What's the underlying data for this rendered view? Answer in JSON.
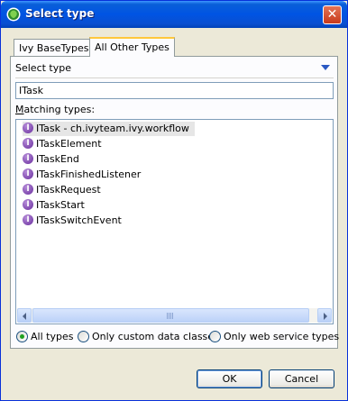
{
  "window": {
    "title": "Select type"
  },
  "tabs": [
    {
      "label": "Ivy BaseTypes"
    },
    {
      "label": "All Other Types"
    }
  ],
  "section": {
    "label": "Select type"
  },
  "search": {
    "value": "ITask"
  },
  "matching": {
    "label_prefix": "",
    "label_mnemonic": "M",
    "label_rest": "atching types:"
  },
  "list": {
    "items": [
      {
        "label": "ITask - ch.ivyteam.ivy.workflow",
        "icon": "interface-icon",
        "selected": true
      },
      {
        "label": "ITaskElement",
        "icon": "interface-icon"
      },
      {
        "label": "ITaskEnd",
        "icon": "interface-icon"
      },
      {
        "label": "ITaskFinishedListener",
        "icon": "interface-icon"
      },
      {
        "label": "ITaskRequest",
        "icon": "interface-icon"
      },
      {
        "label": "ITaskStart",
        "icon": "interface-icon"
      },
      {
        "label": "ITaskSwitchEvent",
        "icon": "interface-icon"
      }
    ],
    "icon_glyph": "I"
  },
  "filters": [
    {
      "label": "All types",
      "checked": true
    },
    {
      "label": "Only custom data classes",
      "checked": false
    },
    {
      "label": "Only web service types",
      "checked": false
    }
  ],
  "buttons": {
    "ok": "OK",
    "cancel": "Cancel"
  },
  "colors": {
    "titlebar": "#0054e3",
    "active_tab_accent": "#ffc83c",
    "interface_icon": "#6a2e9e"
  }
}
